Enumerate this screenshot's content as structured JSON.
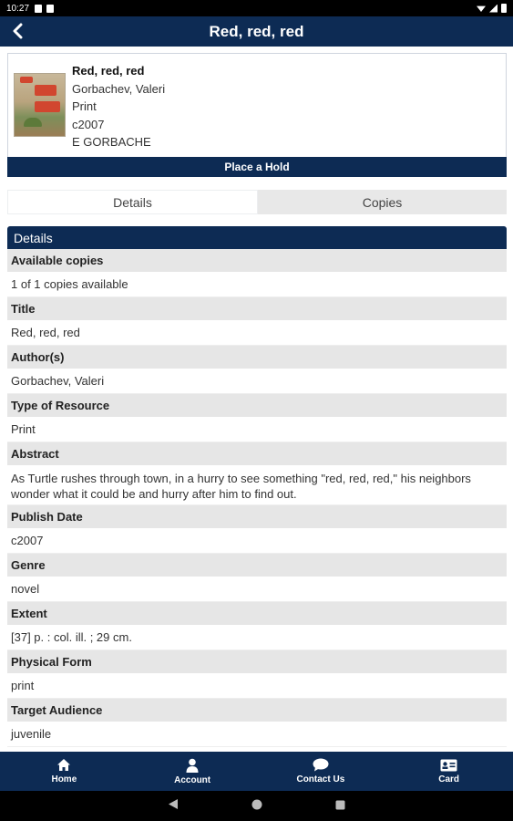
{
  "status_bar": {
    "time": "10:27"
  },
  "app_bar": {
    "title": "Red, red, red"
  },
  "record": {
    "title": "Red, red, red",
    "author": "Gorbachev, Valeri",
    "format": "Print",
    "date": "c2007",
    "call_number": "E GORBACHE"
  },
  "hold_button": {
    "label": "Place a Hold"
  },
  "tabs": [
    {
      "label": "Details"
    },
    {
      "label": "Copies"
    }
  ],
  "details": {
    "header": "Details",
    "fields": [
      {
        "label": "Available copies",
        "value": "1 of 1 copies available"
      },
      {
        "label": "Title",
        "value": "Red, red, red"
      },
      {
        "label": "Author(s)",
        "value": "Gorbachev, Valeri"
      },
      {
        "label": "Type of Resource",
        "value": "Print"
      },
      {
        "label": "Abstract",
        "value": "As Turtle rushes through town, in a hurry to see something \"red, red, red,\" his neighbors wonder what it could be and hurry after him to find out."
      },
      {
        "label": "Publish Date",
        "value": "c2007"
      },
      {
        "label": "Genre",
        "value": "novel"
      },
      {
        "label": "Extent",
        "value": "[37] p. : col. ill. ; 29 cm."
      },
      {
        "label": "Physical Form",
        "value": "print"
      },
      {
        "label": "Target Audience",
        "value": "juvenile"
      }
    ]
  },
  "bottom_nav": [
    {
      "label": "Home",
      "icon": "home-icon"
    },
    {
      "label": "Account",
      "icon": "person-icon"
    },
    {
      "label": "Contact Us",
      "icon": "chat-bubble-icon"
    },
    {
      "label": "Card",
      "icon": "id-card-icon"
    }
  ],
  "colors": {
    "primary": "#0d2b54",
    "label_bg": "#e6e6e6"
  }
}
